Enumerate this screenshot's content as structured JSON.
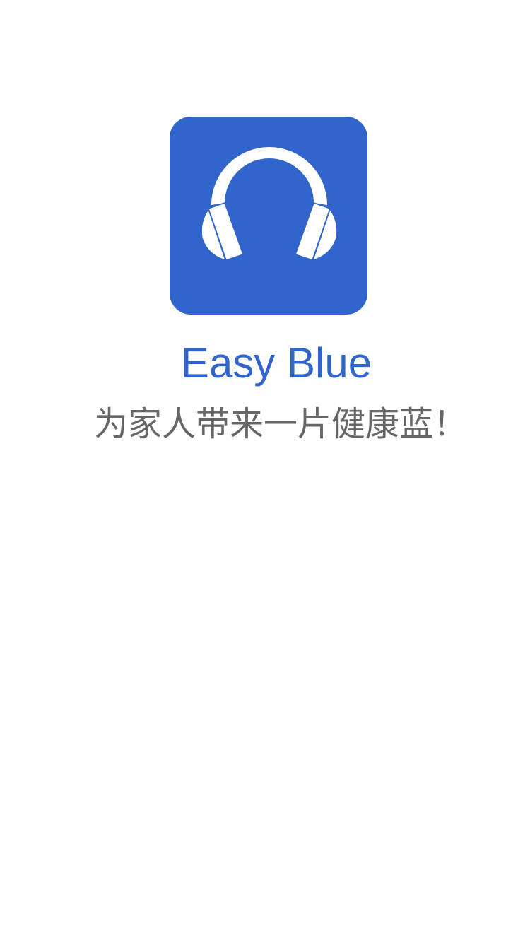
{
  "app": {
    "icon": "headphones-icon",
    "name": "Easy Blue",
    "slogan": "为家人带来一片健康蓝！"
  },
  "colors": {
    "brand": "#3165CC",
    "slogan": "#666666",
    "background": "#FFFFFF"
  }
}
